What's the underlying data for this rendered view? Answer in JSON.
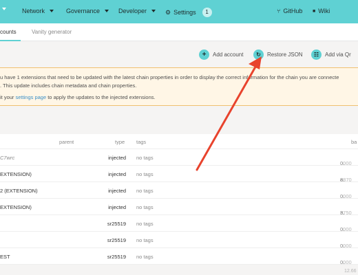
{
  "topbar": {
    "menu_caret": "",
    "network_label": "Network",
    "governance_label": "Governance",
    "developer_label": "Developer",
    "settings_label": "Settings",
    "settings_badge": "1",
    "github_label": "GitHub",
    "wiki_label": "Wiki",
    "settings_icon": "⚙︎",
    "github_icon": "⑂",
    "wiki_icon": "■"
  },
  "subnav": {
    "tabs": [
      {
        "label": "counts"
      },
      {
        "label": "Vanity generator"
      }
    ]
  },
  "actions": {
    "add_account": "Add account",
    "restore_json": "Restore JSON",
    "add_via_qr": "Add via Qr",
    "add_icon": "+",
    "restore_icon": "↻",
    "qr_icon": "☷"
  },
  "banner": {
    "line1": "u have 1 extensions that need to be updated with the latest chain properties in order to display the correct information for the chain you are connecte",
    "line2": ". This update includes chain metadata and chain properties.",
    "line3_pre": "it your ",
    "line3_link": "settings page",
    "line3_post": " to apply the updates to the injected extensions."
  },
  "table": {
    "headers": {
      "parent": "parent",
      "type": "type",
      "tags": "tags",
      "balance": "ba"
    },
    "rows": [
      {
        "name": "C7wrc",
        "type": "injected",
        "tags": "no tags",
        "bal_int": "0.",
        "bal_frac": "0000"
      },
      {
        "name": "EXTENSION)",
        "type": "injected",
        "tags": "no tags",
        "bal_int": "8.",
        "bal_frac": "9870"
      },
      {
        "name": "2 (EXTENSION)",
        "type": "injected",
        "tags": "no tags",
        "bal_int": "0.",
        "bal_frac": "0000"
      },
      {
        "name": "EXTENSION)",
        "type": "injected",
        "tags": "no tags",
        "bal_int": "3.",
        "bal_frac": "6750"
      },
      {
        "name": "",
        "type": "sr25519",
        "tags": "no tags",
        "bal_int": "0.",
        "bal_frac": "0000"
      },
      {
        "name": "",
        "type": "sr25519",
        "tags": "no tags",
        "bal_int": "0.",
        "bal_frac": "0000"
      },
      {
        "name": "EST",
        "type": "sr25519",
        "tags": "no tags",
        "bal_int": "0.",
        "bal_frac": "0000"
      }
    ],
    "footer_total": "12.66"
  },
  "colors": {
    "accent": "#5fd1d3",
    "warning_bg": "#fff6e6",
    "warning_border": "#f0c070",
    "arrow": "#e8432d",
    "link": "#3a8fc7"
  }
}
